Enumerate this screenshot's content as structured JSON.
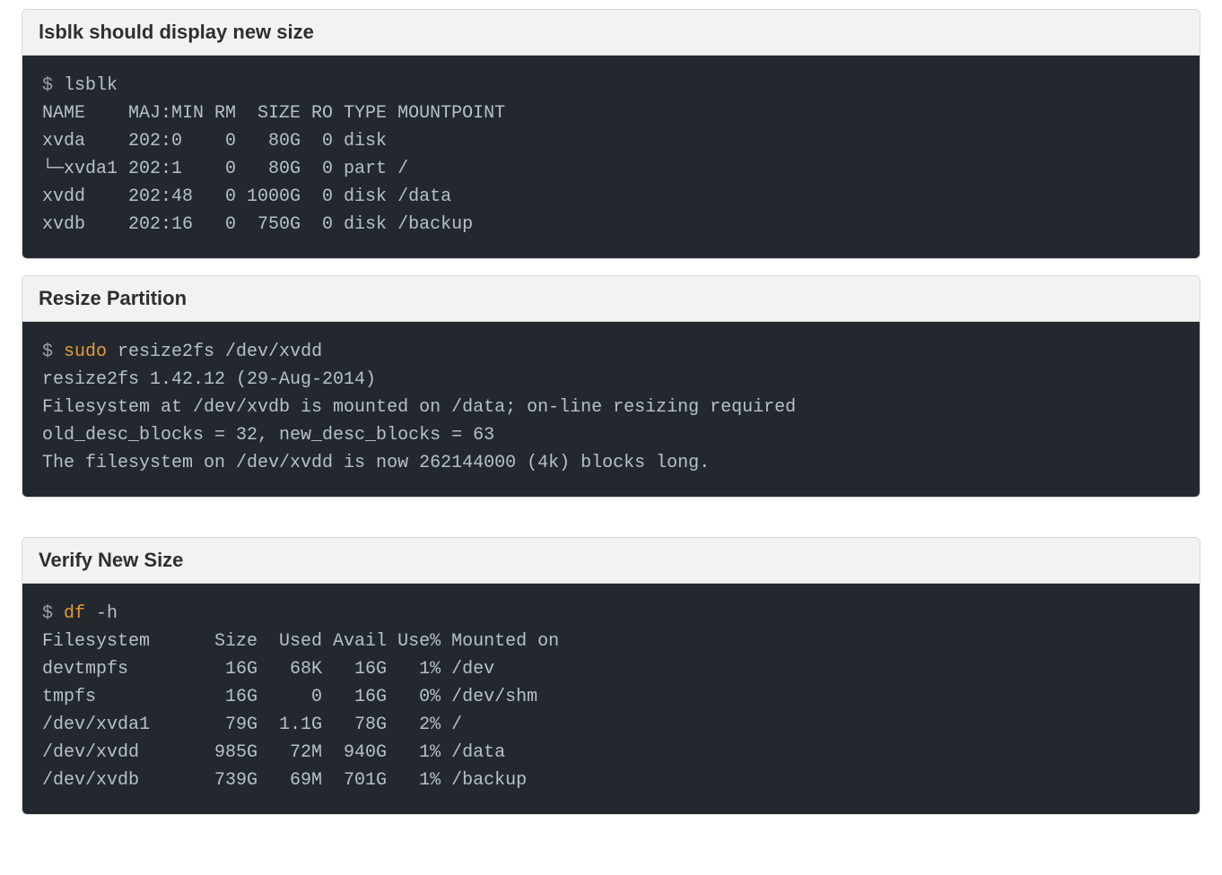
{
  "blocks": [
    {
      "title": "lsblk should display new size",
      "lines": [
        {
          "segs": [
            {
              "t": "$ ",
              "cls": "prompt"
            },
            {
              "t": "lsblk"
            }
          ]
        },
        {
          "segs": [
            {
              "t": "NAME    MAJ:MIN RM  SIZE RO TYPE MOUNTPOINT"
            }
          ]
        },
        {
          "segs": [
            {
              "t": "xvda    202:0    0   80G  0 disk"
            }
          ]
        },
        {
          "segs": [
            {
              "t": "└─xvda1 202:1    0   80G  0 part /"
            }
          ]
        },
        {
          "segs": [
            {
              "t": "xvdd    202:48   0 1000G  0 disk /data"
            }
          ]
        },
        {
          "segs": [
            {
              "t": "xvdb    202:16   0  750G  0 disk /backup"
            }
          ]
        }
      ]
    },
    {
      "title": "Resize Partition",
      "lines": [
        {
          "segs": [
            {
              "t": "$ ",
              "cls": "prompt"
            },
            {
              "t": "sudo ",
              "cls": "sudo"
            },
            {
              "t": "resize2fs /dev/xvdd"
            }
          ]
        },
        {
          "segs": [
            {
              "t": "resize2fs 1.42.12 (29-Aug-2014)"
            }
          ]
        },
        {
          "segs": [
            {
              "t": "Filesystem at /dev/xvdb is mounted on /data; on-line resizing required"
            }
          ]
        },
        {
          "segs": [
            {
              "t": "old_desc_blocks = 32, new_desc_blocks = 63"
            }
          ]
        },
        {
          "segs": [
            {
              "t": "The filesystem on /dev/xvdd is now 262144000 (4k) blocks long."
            }
          ]
        }
      ]
    },
    {
      "title": "Verify New Size",
      "spacerAbove": true,
      "lines": [
        {
          "segs": [
            {
              "t": "$ ",
              "cls": "prompt"
            },
            {
              "t": "df ",
              "cls": "sudo"
            },
            {
              "t": "-h"
            }
          ]
        },
        {
          "segs": [
            {
              "t": "Filesystem      Size  Used Avail Use% Mounted on"
            }
          ]
        },
        {
          "segs": [
            {
              "t": "devtmpfs         16G   68K   16G   1% /dev"
            }
          ]
        },
        {
          "segs": [
            {
              "t": "tmpfs            16G     0   16G   0% /dev/shm"
            }
          ]
        },
        {
          "segs": [
            {
              "t": "/dev/xvda1       79G  1.1G   78G   2% /"
            }
          ]
        },
        {
          "segs": [
            {
              "t": "/dev/xvdd       985G   72M  940G   1% /data"
            }
          ]
        },
        {
          "segs": [
            {
              "t": "/dev/xvdb       739G   69M  701G   1% /backup"
            }
          ]
        }
      ]
    }
  ]
}
